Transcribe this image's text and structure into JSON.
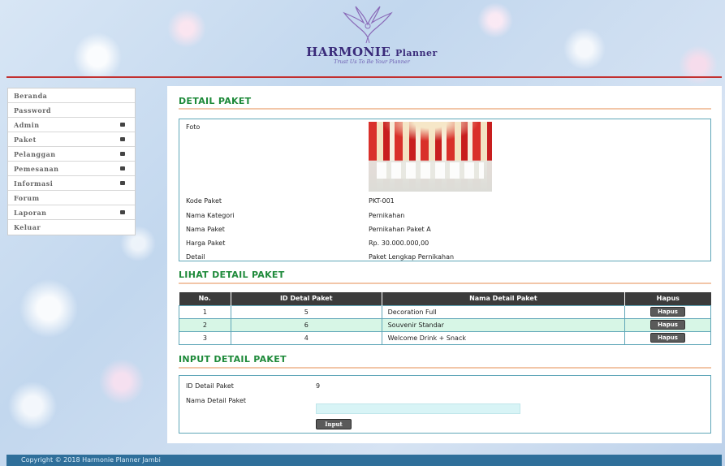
{
  "header": {
    "title_main": "HARMONIE",
    "title_sub": "Planner",
    "tagline": "Trust Us To Be Your Planner"
  },
  "sidebar": {
    "items": [
      {
        "label": "Beranda",
        "has_arrow": false
      },
      {
        "label": "Password",
        "has_arrow": false
      },
      {
        "label": "Admin",
        "has_arrow": true
      },
      {
        "label": "Paket",
        "has_arrow": true
      },
      {
        "label": "Pelanggan",
        "has_arrow": true
      },
      {
        "label": "Pemesanan",
        "has_arrow": true
      },
      {
        "label": "Informasi",
        "has_arrow": true
      },
      {
        "label": "Forum",
        "has_arrow": false
      },
      {
        "label": "Laporan",
        "has_arrow": true
      },
      {
        "label": "Keluar",
        "has_arrow": false
      }
    ]
  },
  "detail": {
    "title": "DETAIL PAKET",
    "photo_label": "Foto",
    "fields": [
      {
        "label": "Kode Paket",
        "value": "PKT-001"
      },
      {
        "label": "Nama Kategori",
        "value": "Pernikahan"
      },
      {
        "label": "Nama Paket",
        "value": "Pernikahan Paket A"
      },
      {
        "label": "Harga Paket",
        "value": "Rp. 30.000.000,00"
      },
      {
        "label": "Detail",
        "value": "Paket Lengkap Pernikahan"
      }
    ]
  },
  "lihat": {
    "title": "LIHAT DETAIL PAKET",
    "columns": [
      "No.",
      "ID Detal Paket",
      "Nama Detail Paket",
      "Hapus"
    ],
    "rows": [
      {
        "no": "1",
        "id": "5",
        "nama": "Decoration Full",
        "action": "Hapus"
      },
      {
        "no": "2",
        "id": "6",
        "nama": "Souvenir Standar",
        "action": "Hapus"
      },
      {
        "no": "3",
        "id": "4",
        "nama": "Welcome Drink + Snack",
        "action": "Hapus"
      }
    ]
  },
  "input": {
    "title": "INPUT DETAIL PAKET",
    "id_label": "ID Detail Paket",
    "id_value": "9",
    "nama_label": "Nama Detail Paket",
    "nama_value": "",
    "button_label": "Input"
  },
  "footer": {
    "text": "Copyright © 2018 Harmonie Planner Jambi"
  },
  "colors": {
    "section_title": "#1e8a3a",
    "header_rule": "#c23030",
    "table_header": "#3b3b3b",
    "alt_row": "#d7f6e6",
    "footer_bg": "#2f6f9a"
  }
}
